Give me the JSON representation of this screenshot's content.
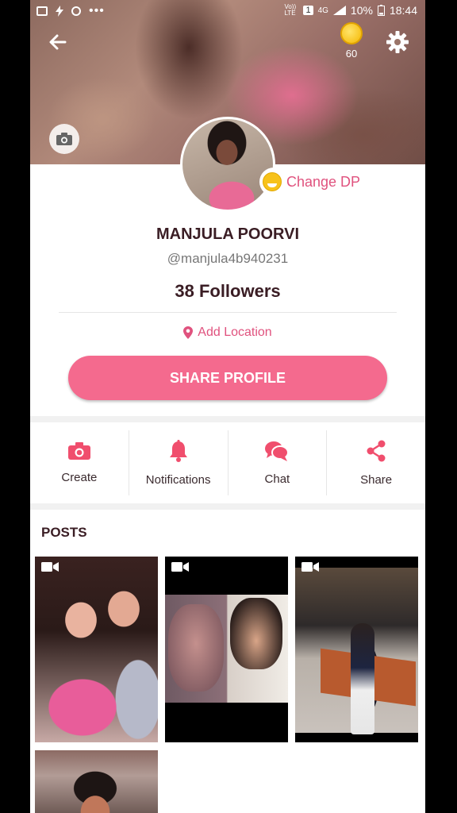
{
  "status_bar": {
    "carrier": "Vo)) LTE",
    "sim": "1",
    "network": "4G",
    "battery": "10%",
    "time": "18:44"
  },
  "header": {
    "coin_count": "60"
  },
  "profile": {
    "change_dp_label": "Change DP",
    "name": "MANJULA POORVI",
    "handle": "@manjula4b940231",
    "followers": "38 Followers",
    "add_location": "Add Location",
    "share_button": "SHARE PROFILE"
  },
  "actions": [
    {
      "label": "Create",
      "icon": "camera-icon"
    },
    {
      "label": "Notifications",
      "icon": "bell-icon"
    },
    {
      "label": "Chat",
      "icon": "chat-bubbles-icon"
    },
    {
      "label": "Share",
      "icon": "share-icon"
    }
  ],
  "posts": {
    "title": "POSTS"
  },
  "colors": {
    "accent": "#f46a8e",
    "accent_text": "#e0527e",
    "name_text": "#3a1d24"
  }
}
